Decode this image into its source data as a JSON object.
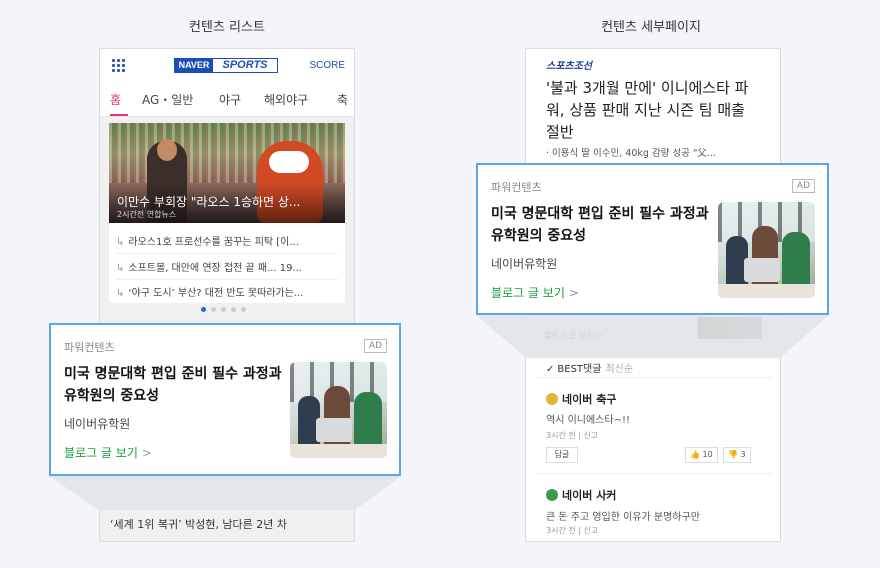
{
  "captions": {
    "left": "컨텐츠 리스트",
    "right": "컨텐츠 세부페이지"
  },
  "left_phone": {
    "logo": {
      "naver": "NAVER",
      "sports": "SPORTS"
    },
    "score_label": "SCORE",
    "tabs": [
      "홈",
      "AG・일반",
      "야구",
      "해외야구",
      "축"
    ],
    "active_tab": "홈",
    "headline": {
      "title": "이만수 부회장 \"라오스 1승하면 상...",
      "sub": "2시간전 연합뉴스"
    },
    "list": [
      "라오스1호 프로선수를 꿈꾸는 피탁 [이...",
      "소프트볼, 대만에 연장 접전 끝 패... 19...",
      "‘야구 도시’ 부산? 대전 반도 못따라가는..."
    ],
    "under_blog_link": "블로그 글 보기 >",
    "bottom_text": "‘세계 1위 복귀’ 박성현, 남다른 2년 차"
  },
  "right_phone": {
    "press": "스포츠조선",
    "title": "'불과 3개월 만에' 이니에스타 파워, 상품 판매 지난 시즌 팀 매출 절반",
    "sub": "· 이용식 딸 이수민, 40kg 감량 성공 \"父...",
    "under_blog_link": "블로그 글 보기 >",
    "best": {
      "check": "✓",
      "label": "BEST댓글",
      "latest": "최신순"
    },
    "comments": [
      {
        "name": "네이버 축구",
        "text": "역시 이니에스타~!!",
        "time": "3시간 전",
        "report": "신고",
        "reply": "답글",
        "likes": "10",
        "dislikes": "3"
      },
      {
        "name": "네이버 사커",
        "text": "큰 돈 주고 영입한 이유가 분명하구만",
        "time": "3시간 전",
        "report": "신고"
      }
    ]
  },
  "ad": {
    "label": "파워컨텐츠",
    "badge": "AD",
    "title": "미국 명문대학 편입 준비 필수 과정과 유학원의 중요성",
    "source": "네이버유학원",
    "link": "블로그 글 보기",
    "chevron": ">"
  },
  "colors": {
    "accent_blue": "#5aa6e6",
    "link_green": "#1a9e3a",
    "active_tab": "#e23a72",
    "naver_blue": "#1d4eb5"
  },
  "icons": {
    "grid": "grid-menu-icon",
    "check": "check-icon",
    "gold_medal": "gold-medal-icon",
    "green_medal": "green-medal-icon"
  }
}
